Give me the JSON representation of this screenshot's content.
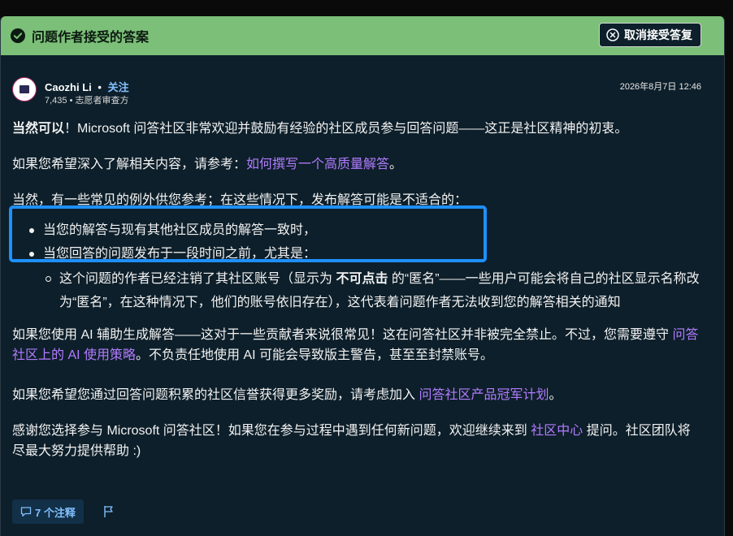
{
  "accepted_bar": {
    "title": "问题作者接受的答案",
    "unaccept_label": "取消接受答复"
  },
  "author": {
    "name": "Caozhi Li",
    "separator": "•",
    "follow_label": "关注",
    "meta": "7,435 • 志愿者审查方",
    "date": "2026年8月7日 12:46"
  },
  "body": {
    "p1_bold": "当然可以",
    "p1_rest": "！Microsoft 问答社区非常欢迎并鼓励有经验的社区成员参与回答问题——这正是社区精神的初衷。",
    "p2_text": "如果您希望深入了解相关内容，请参考：",
    "p2_link": "如何撰写一个高质量解答",
    "p2_end": "。",
    "p3_text": "当然，有一些常见的例外供您参考；在这些情况下，发布解答可能是不适合的：",
    "bullet1": "当您的解答与现有其他社区成员的解答一致时，",
    "bullet2": "当您回答的问题发布于一段时间之前，尤其是：",
    "sub1_a": "这个问题的作者已经注销了其社区账号（显示为 ",
    "sub1_bold": "不可点击",
    "sub1_b": " 的“匿名”——一些用户可能会将自己的社区显示名称改为“匿名”，在这种情况下，他们的账号依旧存在），这代表着问题作者无法收到您的解答相关的通知",
    "p4_text": "如果您使用 AI 辅助生成解答——这对于一些贡献者来说很常见！这在问答社区并非被完全禁止。不过，您需要遵守 ",
    "p4_link": "问答社区上的 AI 使用策略",
    "p4_end": "。不负责任地使用 AI 可能会导致版主警告，甚至至封禁账号。",
    "p5_text": "如果您希望您通过回答问题积累的社区信誉获得更多奖励，请考虑加入 ",
    "p5_link": "问答社区产品冠军计划",
    "p5_end": "。",
    "p6_text": "感谢您选择参与 Microsoft 问答社区！如果您在参与过程中遇到任何新问题，欢迎继续来到 ",
    "p6_link": "社区中心",
    "p6_end": " 提问。社区团队将尽最大努力提供帮助 :)"
  },
  "footer": {
    "comments_label": "7 个注释"
  },
  "colors": {
    "accepted_bg": "#7bbf78",
    "panel_bg": "#0d1f2a",
    "link": "#b27bff",
    "follow": "#82c0ff",
    "highlight": "#1e90ff"
  },
  "icons": {
    "accepted": "check-circle-icon",
    "unaccept": "close-circle-icon",
    "comments": "comment-icon",
    "flag": "flag-icon"
  }
}
